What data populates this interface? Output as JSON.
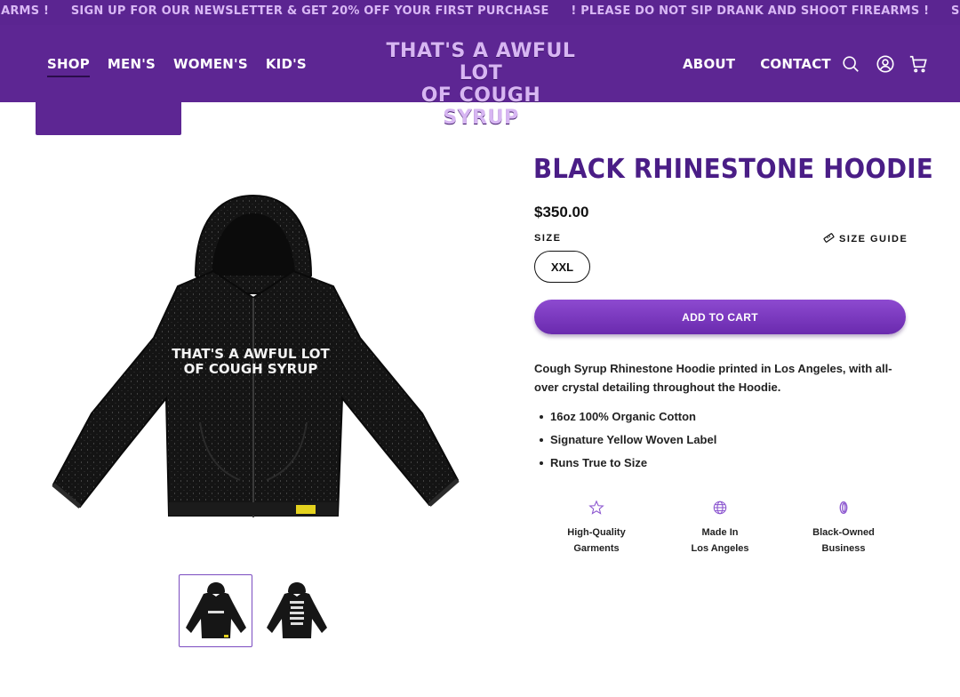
{
  "announcement": {
    "items": [
      "EARMS !",
      "SIGN UP FOR OUR NEWSLETTER & GET 20% OFF YOUR FIRST PURCHASE",
      "! PLEASE DO NOT SIP DRANK AND SHOOT FIREARMS !",
      "SIGN UP FOR OUR NEW"
    ]
  },
  "header": {
    "nav_left": [
      "SHOP",
      "MEN'S",
      "WOMEN'S",
      "KID'S"
    ],
    "active_nav": "SHOP",
    "logo_line1": "THAT'S A AWFUL LOT",
    "logo_line2": "OF COUGH SYRUP",
    "nav_right": [
      "ABOUT",
      "CONTACT"
    ],
    "icons": [
      "search-icon",
      "account-icon",
      "cart-icon"
    ]
  },
  "product": {
    "title": "BLACK RHINESTONE HOODIE",
    "price": "$350.00",
    "size_label": "SIZE",
    "size_guide": "SIZE GUIDE",
    "selected_size": "XXL",
    "add_to_cart": "ADD TO CART",
    "description": "Cough Syrup Rhinestone Hoodie printed in Los Angeles, with all-over crystal detailing throughout the Hoodie.",
    "bullets": [
      "16oz 100% Organic Cotton",
      "Signature Yellow Woven Label",
      "Runs True to Size"
    ],
    "image_print_line1": "THAT'S A AWFUL LOT",
    "image_print_line2": "OF COUGH SYRUP",
    "back_print": "THAT'S A AWFUL LOT OF COUGH SYRUP",
    "features": [
      {
        "icon": "star-icon",
        "line1": "High-Quality",
        "line2": "Garments"
      },
      {
        "icon": "globe-icon",
        "line1": "Made In",
        "line2": "Los Angeles"
      },
      {
        "icon": "ring-icon",
        "line1": "Black-Owned",
        "line2": "Business"
      }
    ]
  },
  "colors": {
    "brand_purple": "#5d2693",
    "title_purple": "#4a1d86",
    "button_purple": "#7a3bc0",
    "logo_lavender": "#d7b6f2"
  }
}
